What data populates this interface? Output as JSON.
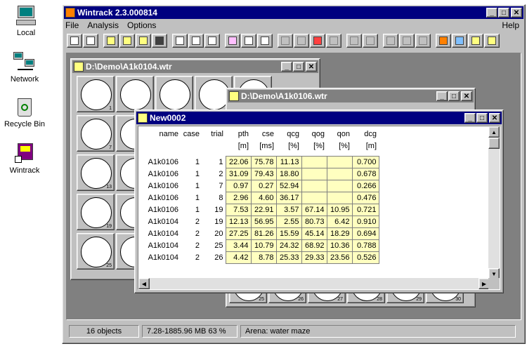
{
  "desktop": {
    "icons": [
      {
        "label": "Local"
      },
      {
        "label": "Network"
      },
      {
        "label": "Recycle Bin"
      },
      {
        "label": "Wintrack"
      }
    ]
  },
  "app": {
    "title": "Wintrack 2.3.000814",
    "menu": [
      "File",
      "Analysis",
      "Options"
    ],
    "help": "Help"
  },
  "window1": {
    "title": "D:\\Demo\\A1k0104.wtr",
    "track_numbers": [
      "1",
      "7",
      "13",
      "19",
      "25"
    ]
  },
  "window2": {
    "title": "D:\\Demo\\A1k0106.wtr",
    "track_numbers": [
      "25",
      "26",
      "27",
      "28",
      "29",
      "30"
    ]
  },
  "table_window": {
    "title": "New0002",
    "columns": [
      "name",
      "case",
      "trial",
      "pth",
      "cse",
      "qcg",
      "qog",
      "qon",
      "dcg"
    ],
    "units": [
      "",
      "",
      "",
      "[m]",
      "[ms]",
      "[%]",
      "[%]",
      "[%]",
      "[m]"
    ],
    "rows": [
      [
        "A1k0106",
        "1",
        "1",
        "22.06",
        "75.78",
        "11.13",
        "",
        "",
        "0.700"
      ],
      [
        "A1k0106",
        "1",
        "2",
        "31.09",
        "79.43",
        "18.80",
        "",
        "",
        "0.678"
      ],
      [
        "A1k0106",
        "1",
        "7",
        "0.97",
        "0.27",
        "52.94",
        "",
        "",
        "0.266"
      ],
      [
        "A1k0106",
        "1",
        "8",
        "2.96",
        "4.60",
        "36.17",
        "",
        "",
        "0.476"
      ],
      [
        "A1k0106",
        "1",
        "19",
        "7.53",
        "22.91",
        "3.57",
        "67.14",
        "10.95",
        "0.721"
      ],
      [
        "A1k0104",
        "2",
        "19",
        "12.13",
        "56.95",
        "2.55",
        "80.73",
        "6.42",
        "0.910"
      ],
      [
        "A1k0104",
        "2",
        "20",
        "27.25",
        "81.26",
        "15.59",
        "45.14",
        "18.29",
        "0.694"
      ],
      [
        "A1k0104",
        "2",
        "25",
        "3.44",
        "10.79",
        "24.32",
        "68.92",
        "10.36",
        "0.788"
      ],
      [
        "A1k0104",
        "2",
        "26",
        "4.42",
        "8.78",
        "25.33",
        "29.33",
        "23.56",
        "0.526"
      ]
    ]
  },
  "status": {
    "objects": "16 objects",
    "memory": "7.28-1885.96 MB  63 %",
    "arena": "Arena: water maze"
  }
}
